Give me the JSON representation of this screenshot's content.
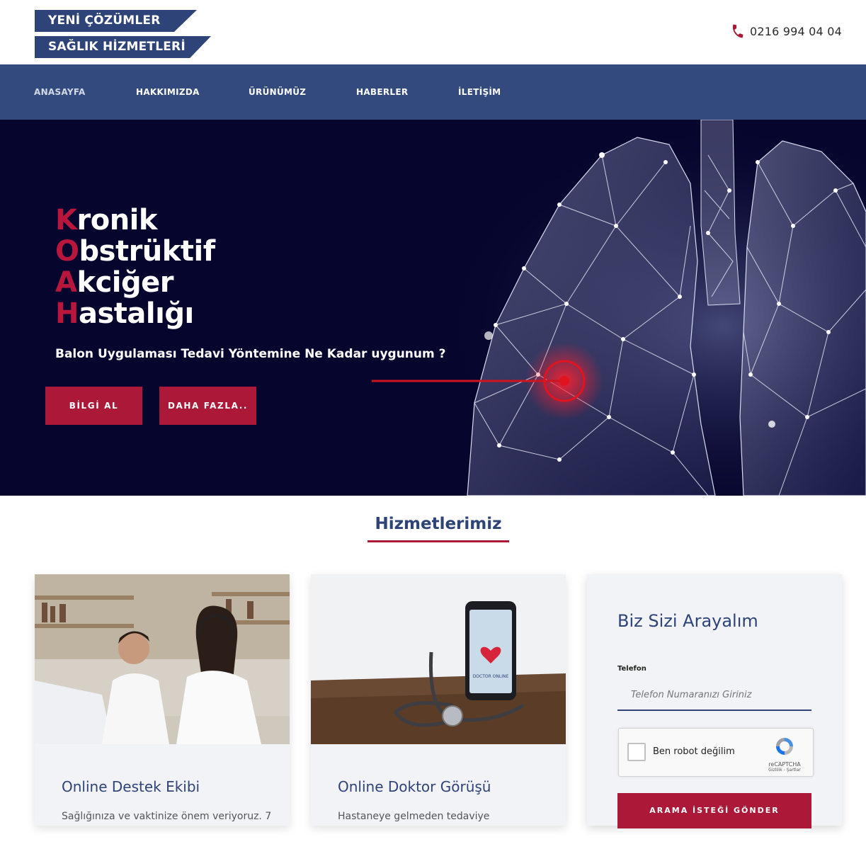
{
  "header": {
    "logo_line1": "YENİ ÇÖZÜMLER",
    "logo_line2": "SAĞLIK HİZMETLERİ",
    "phone": "0216 994 04 04"
  },
  "nav": {
    "items": [
      {
        "label": "ANASAYFA",
        "active": true
      },
      {
        "label": "HAKKIMIZDA"
      },
      {
        "label": "ÜRÜNÜMÜZ"
      },
      {
        "label": "HABERLER"
      },
      {
        "label": "İLETİŞİM"
      }
    ]
  },
  "hero": {
    "lines": [
      {
        "first": "K",
        "rest": "ronik"
      },
      {
        "first": "O",
        "rest": "bstrüktif"
      },
      {
        "first": "A",
        "rest": "kciğer"
      },
      {
        "first": "H",
        "rest": "astalığı"
      }
    ],
    "subtitle": "Balon Uygulaması Tedavi Yöntemine Ne Kadar uygunum ?",
    "btn_info": "BİLGİ AL",
    "btn_more": "DAHA FAZLA.."
  },
  "services": {
    "title": "Hizmetlerimiz",
    "cards": [
      {
        "title": "Online Destek Ekibi",
        "text": "Sağlığınıza ve vaktinize önem veriyoruz. 7"
      },
      {
        "title": "Online Doktor Görüşü",
        "text": "Hastaneye gelmeden tedaviye",
        "phone_screen": "DOCTOR ONLINE"
      }
    ]
  },
  "callback_form": {
    "title": "Biz Sizi Arayalım",
    "phone_label": "Telefon",
    "phone_placeholder": "Telefon Numaranızı Giriniz",
    "captcha_label": "Ben robot değilim",
    "captcha_brand": "reCAPTCHA",
    "captcha_links": "Gizlilik - Şartlar",
    "submit": "ARAMA İSTEĞİ GÖNDER"
  },
  "colors": {
    "navy": "#334a7e",
    "brand_red": "#ab1838",
    "hero_bg": "#06052e"
  }
}
